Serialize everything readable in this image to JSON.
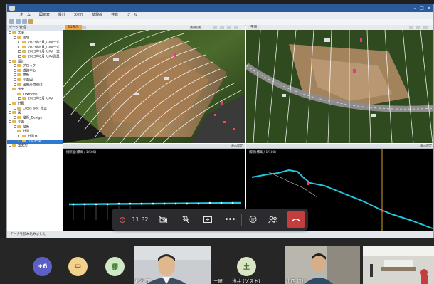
{
  "window": {
    "title": "",
    "menu": [
      "ホーム",
      "図面表",
      "設計",
      "3次元",
      "試験線",
      "共有",
      "ツール"
    ]
  },
  "tree": {
    "header": "データ管理",
    "items": [
      {
        "label": "工事",
        "level": 0,
        "sel": false
      },
      {
        "label": "現場",
        "level": 1,
        "sel": false
      },
      {
        "label": "2023年5月_UAV一式",
        "level": 2,
        "sel": false
      },
      {
        "label": "2023年6月_UAV一式",
        "level": 2,
        "sel": false
      },
      {
        "label": "2023年7月_UAV一式",
        "level": 2,
        "sel": false
      },
      {
        "label": "2023年8月_UAV測量",
        "level": 2,
        "sel": false
      },
      {
        "label": "設計",
        "level": 0,
        "sel": false
      },
      {
        "label": "ブロック",
        "level": 1,
        "sel": false
      },
      {
        "label": "道路中心",
        "level": 1,
        "sel": false
      },
      {
        "label": "横断",
        "level": 1,
        "sel": false
      },
      {
        "label": "平面図",
        "level": 1,
        "sel": false
      },
      {
        "label": "出来形管理(2)",
        "level": 1,
        "sel": false
      },
      {
        "label": "出来",
        "level": 0,
        "sel": false
      },
      {
        "label": "TINmodel",
        "level": 1,
        "sel": false
      },
      {
        "label": "2023年5月_UAV",
        "level": 2,
        "sel": false
      },
      {
        "label": "計画",
        "level": 0,
        "sel": false
      },
      {
        "label": "Cross_sec_修正",
        "level": 1,
        "sel": false
      },
      {
        "label": "図",
        "level": 0,
        "sel": false
      },
      {
        "label": "縦断_Design",
        "level": 1,
        "sel": false
      },
      {
        "label": "平面",
        "level": 0,
        "sel": false
      },
      {
        "label": "縦断",
        "level": 1,
        "sel": false
      },
      {
        "label": "計測",
        "level": 1,
        "sel": false
      },
      {
        "label": "計測点",
        "level": 2,
        "sel": false
      },
      {
        "label": "工区記録",
        "level": 2,
        "sel": true
      },
      {
        "label": "出来形",
        "level": 0,
        "sel": false
      }
    ]
  },
  "views": {
    "left3d": {
      "tab": "3D表示",
      "mode": "透視投影"
    },
    "right3d": {
      "tab": "平面"
    },
    "graph_left": {
      "label": "縦断図(標高 / 1/500)"
    },
    "graph_right": {
      "label": "横断(標高 / 1/100)"
    },
    "graph_bar": "表示設定"
  },
  "statusbar": "データを読み込みました",
  "meeting": {
    "time": "11:32",
    "participants": [
      {
        "badge": "+6",
        "color": "#5b5fc7",
        "text": "#ffffff"
      },
      {
        "badge": "中",
        "color": "#f2d28c",
        "text": "#8a6a1c"
      },
      {
        "badge": "藤",
        "color": "#cfe8c5",
        "text": "#3d7a2a"
      },
      {
        "badge": "土",
        "color": "#d8e6c6",
        "text": "#4b6b2c"
      }
    ],
    "names": [
      "杉本 正",
      "土屋",
      "浅井 (ゲスト)",
      "小西 智也"
    ]
  },
  "colors": {
    "leave": "#c43e3e",
    "accent": "#2f7ad0",
    "profile": "#1fc8e0"
  }
}
